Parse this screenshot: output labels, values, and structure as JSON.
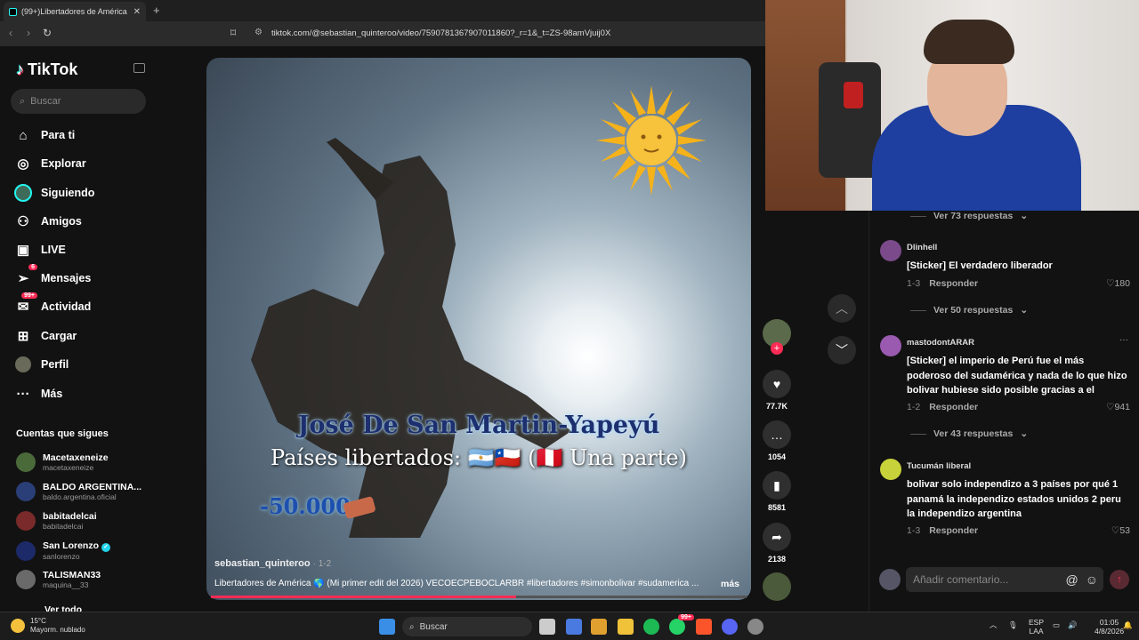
{
  "browser": {
    "tab_title": "(99+)Libertadores de América",
    "url": "tiktok.com/@sebastian_quinteroo/video/7590781367907011860?_r=1&_t=ZS-98amVjuij0X"
  },
  "sidebar": {
    "logo": "TikTok",
    "search_placeholder": "Buscar",
    "nav": [
      {
        "label": "Para ti",
        "icon": "home-icon"
      },
      {
        "label": "Explorar",
        "icon": "compass-icon"
      },
      {
        "label": "Siguiendo",
        "icon": "following-avatar-icon"
      },
      {
        "label": "Amigos",
        "icon": "friends-icon"
      },
      {
        "label": "LIVE",
        "icon": "live-icon"
      },
      {
        "label": "Mensajes",
        "icon": "messages-icon",
        "badge": "6"
      },
      {
        "label": "Actividad",
        "icon": "activity-icon",
        "badge": "99+"
      },
      {
        "label": "Cargar",
        "icon": "upload-icon"
      },
      {
        "label": "Perfil",
        "icon": "profile-icon"
      },
      {
        "label": "Más",
        "icon": "more-icon"
      }
    ],
    "following_title": "Cuentas que sigues",
    "following": [
      {
        "name": "Macetaxeneize",
        "handle": "macetaxeneize",
        "verified": false,
        "color": "#4a6a3a"
      },
      {
        "name": "BALDO ARGENTINA...",
        "handle": "baldo.argentina.oficial",
        "verified": false,
        "color": "#2a3f78"
      },
      {
        "name": "babitadelcai",
        "handle": "babitadelcai",
        "verified": false,
        "color": "#7a2a2a"
      },
      {
        "name": "San Lorenzo",
        "handle": "sanlorenzo",
        "verified": true,
        "color": "#1d2a6a"
      },
      {
        "name": "TALISMAN33",
        "handle": "maquina__33",
        "verified": false,
        "color": "#6a6a6a"
      }
    ],
    "see_all": "Ver todo"
  },
  "video": {
    "overlay_line1": "José De San Martin-Yapeyú",
    "overlay_line2": "Países libertados: 🇦🇷🇨🇱 (🇵🇪 Una parte)",
    "overlay_line3": "-50.000",
    "username": "sebastian_quinteroo",
    "date": "· 1-2",
    "description": "Libertadores de América 🌎 (Mi primer edit del 2026) VECOECPEBOCLARBR #libertadores #simonbolivar #sudamerica ...",
    "more": "más",
    "progress": 0.57
  },
  "actions": {
    "likes": "77.7K",
    "comments": "1054",
    "saves": "8581",
    "shares": "2138"
  },
  "comments": {
    "top_replies": "Ver 73 respuestas",
    "reply_label": "Responder",
    "items": [
      {
        "user": "Dlinhell",
        "text": "[Sticker] El verdadero liberador",
        "date": "1-3",
        "likes": "180",
        "replies": "Ver 50 respuestas",
        "color": "#7a4a8a"
      },
      {
        "user": "mastodontARAR",
        "text": "[Sticker] el imperio de Perú fue el más poderoso del sudamérica y nada de lo que hizo bolivar hubiese sido posible gracias a el",
        "date": "1-2",
        "likes": "941",
        "replies": "Ver 43 respuestas",
        "color": "#9a5ab0"
      },
      {
        "user": "Tucumán liberal",
        "text": "bolivar solo independizo a 3 países por qué 1 panamá la independizo estados unidos 2 peru la independizo argentina",
        "date": "1-3",
        "likes": "53",
        "color": "#c8d23a"
      }
    ],
    "input_placeholder": "Añadir comentario..."
  },
  "taskbar": {
    "temp": "15°C",
    "weather": "Mayorm. nublado",
    "search": "Buscar",
    "lang1": "ESP",
    "lang2": "LAA",
    "time": "01:05",
    "date": "4/8/2026",
    "badge": "99+"
  }
}
